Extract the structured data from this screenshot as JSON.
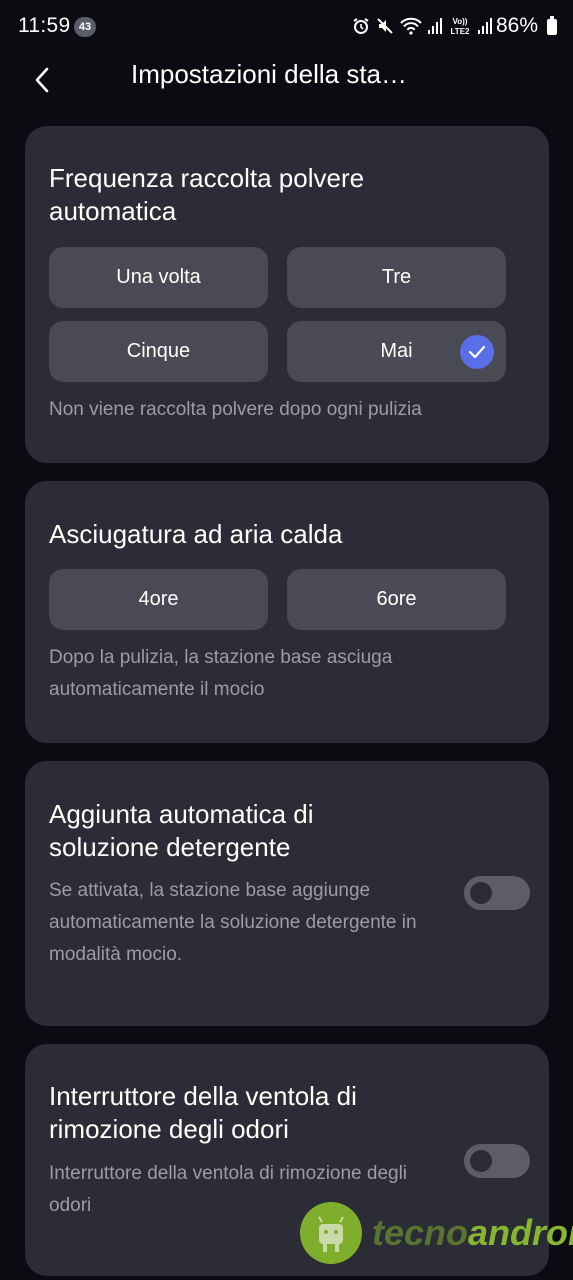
{
  "status_bar": {
    "time": "11:59",
    "notification_count": "43",
    "battery": "86%",
    "icons": [
      "alarm-icon",
      "mute-icon",
      "wifi-icon",
      "signal-icon",
      "volte-icon",
      "signal-icon"
    ],
    "volte_label": "Vo))",
    "lte_label": "LTE2"
  },
  "header": {
    "title": "Impostazioni della sta…"
  },
  "dust": {
    "title": "Frequenza raccolta polvere automatica",
    "options": [
      "Una volta",
      "Tre",
      "Cinque",
      "Mai"
    ],
    "selected": "Mai",
    "description": "Non viene raccolta polvere dopo ogni pulizia"
  },
  "drying": {
    "title": "Asciugatura ad aria calda",
    "options": [
      "4ore",
      "6ore"
    ],
    "description": "Dopo la pulizia, la stazione base asciuga automaticamente il mocio"
  },
  "detergent": {
    "title": "Aggiunta automatica di soluzione detergente",
    "description": "Se attivata, la stazione base aggiunge automaticamente la soluzione detergente in modalità mocio.",
    "enabled": false
  },
  "odor": {
    "title": "Interruttore della ventola di rimozione degli odori",
    "description": "Interruttore della ventola di rimozione degli odori",
    "enabled": false
  },
  "watermark": {
    "text_light": "tecno",
    "text_strong": "android"
  },
  "colors": {
    "background": "#0b0c12",
    "card": "#2b2c35",
    "option": "#494a53",
    "accent": "#5a6ee8",
    "toggle_off": "#5c5d66"
  }
}
